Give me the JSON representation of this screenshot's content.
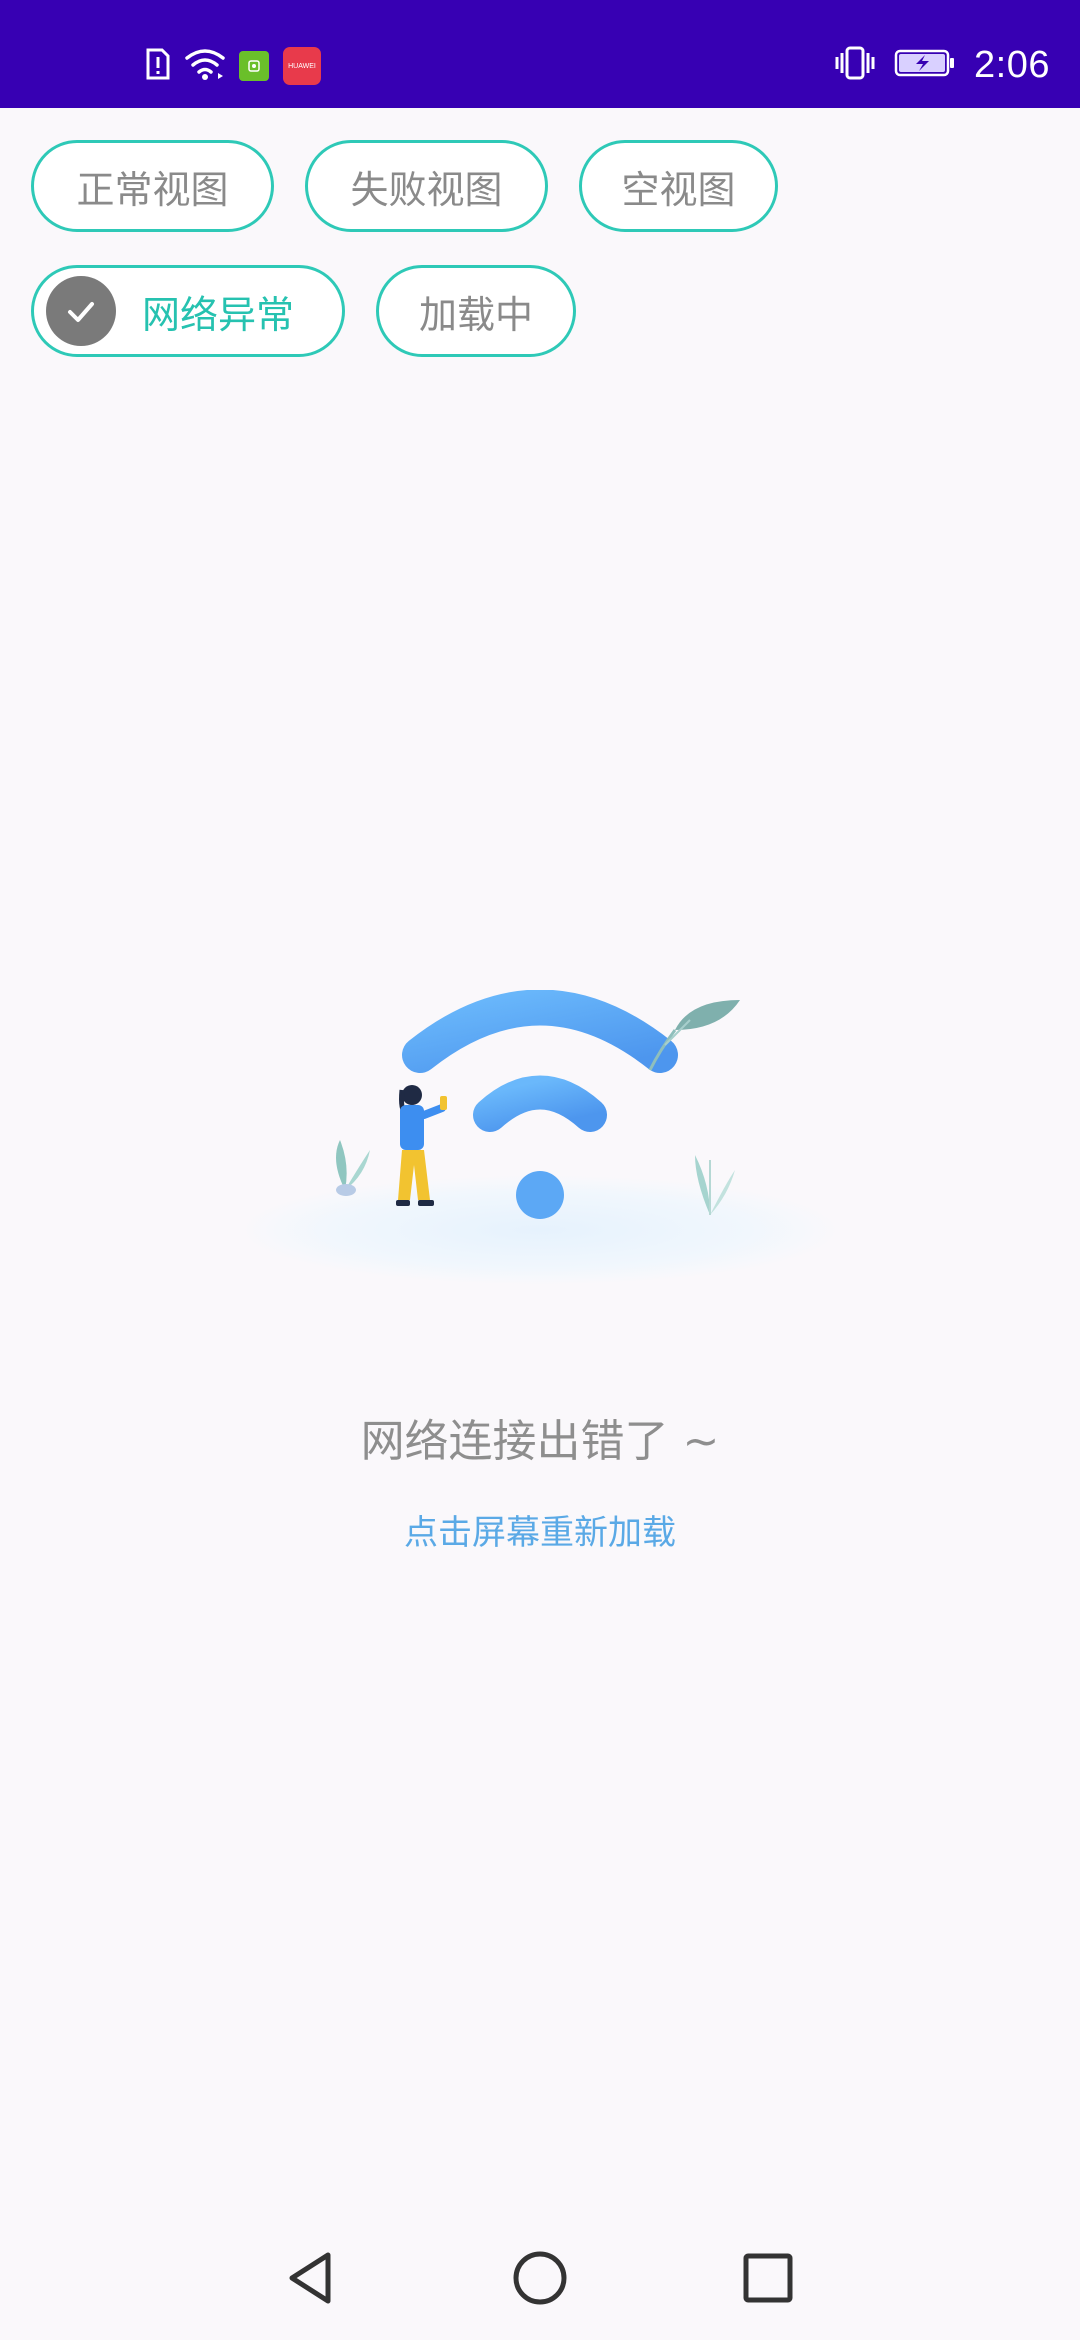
{
  "status_bar": {
    "time": "2:06",
    "notification_app_label": "HUAWEI",
    "background_color": "#3700b3",
    "left_icons": [
      "sim-alert-icon",
      "wifi-icon",
      "green-app-icon",
      "huawei-app-icon"
    ],
    "right_icons": [
      "vibrate-icon",
      "battery-charging-icon"
    ]
  },
  "chips": [
    {
      "label": "正常视图",
      "selected": false
    },
    {
      "label": "失败视图",
      "selected": false
    },
    {
      "label": "空视图",
      "selected": false
    },
    {
      "label": "网络异常",
      "selected": true
    },
    {
      "label": "加载中",
      "selected": false
    }
  ],
  "accent_color": "#2ec9b7",
  "error": {
    "title": "网络连接出错了 ~",
    "retry": "点击屏幕重新加载",
    "illustration_icon": "wifi-illustration-icon"
  },
  "nav_bar": {
    "icons": [
      "back-icon",
      "home-icon",
      "recent-apps-icon"
    ]
  }
}
